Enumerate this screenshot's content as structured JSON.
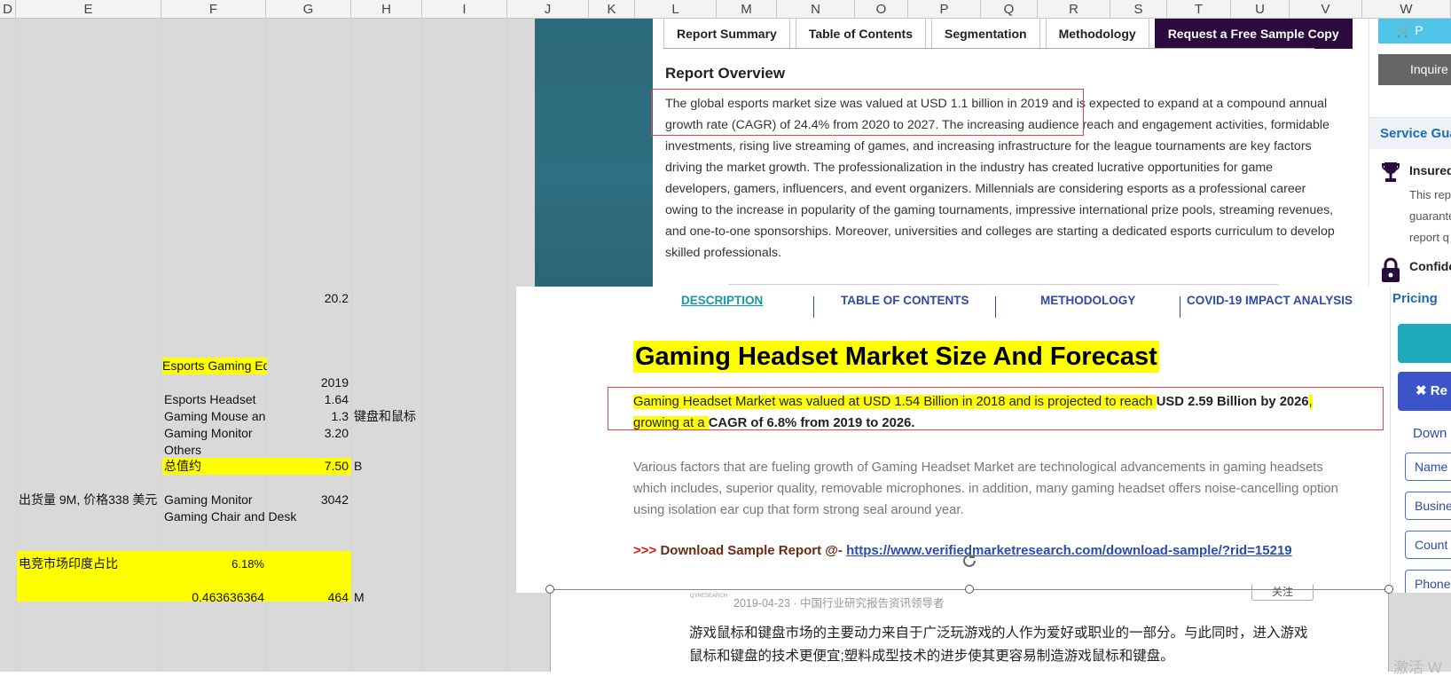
{
  "columns": [
    "D",
    "E",
    "F",
    "G",
    "H",
    "I",
    "J",
    "K",
    "L",
    "M",
    "N",
    "O",
    "P",
    "Q",
    "R",
    "S",
    "T",
    "U",
    "V",
    "W"
  ],
  "sheet": {
    "g_20_2": "20.2",
    "title_equipment": "Esports Gaming Equipment",
    "year": "2019",
    "headset": "Esports Headset",
    "headset_v": "1.64",
    "mouse": "Gaming Mouse and Keyboard",
    "mouse_v": "1.3",
    "mouse_note": "键盘和鼠标",
    "monitor": "Gaming Monitor",
    "monitor_v": "3.20",
    "others": "Others",
    "total": "总值约",
    "total_v": "7.50",
    "total_unit": "B",
    "shipment_note": "出货量 9M, 价格338 美元",
    "monitor2": "Gaming Monitor",
    "monitor2_v": "3042",
    "chair": "Gaming Chair and Desk",
    "india_label": "电竞市场印度占比",
    "india_pct": "6.18%",
    "ratio": "0.463636364",
    "ratio_v": "464",
    "ratio_unit": "M"
  },
  "report": {
    "tabs": [
      "Report Summary",
      "Table of Contents",
      "Segmentation",
      "Methodology",
      "Request a Free Sample Copy"
    ],
    "overview_title": "Report Overview",
    "overview_text": "The global esports market size was valued at USD 1.1 billion in 2019 and is expected to expand at a compound annual growth rate (CAGR) of 24.4% from 2020 to 2027. The increasing audience reach and engagement activities, formidable investments, rising live streaming of games, and increasing infrastructure for the league tournaments are key factors driving the market growth. The professionalization in the industry has created lucrative opportunities for game developers, gamers, influencers, and event organizers. Millennials are considering esports as a professional career owing to the increase in popularity of the gaming tournaments, impressive international prize pools, streaming revenues, and one-to-one sponsorships. Moreover, universities and colleges are starting a dedicated esports curriculum to develop skilled professionals.",
    "btn_cart": "P",
    "btn_inquire": "Inquire",
    "service_title": "Service Gua",
    "svc1_title": "Insured",
    "svc1_desc": "This rep guarante report q",
    "svc2_title": "Confide"
  },
  "headset": {
    "nav": [
      "DESCRIPTION",
      "TABLE OF CONTENTS",
      "METHODOLOGY",
      "COVID-19 IMPACT ANALYSIS"
    ],
    "title": "Gaming Headset Market Size And Forecast",
    "para_a": "Gaming Headset Market was valued at USD 1.54 Billion in 2018 and is projected to reach ",
    "para_b": "USD 2.59 Billion by 2026",
    "para_c": ", growing at a ",
    "para_d": "CAGR of 6.8% from 2019 to 2026.",
    "para2": "Various factors that are fueling growth of Gaming Headset Market are technological advancements in gaming headsets which includes, superior quality, removable microphones. in addition, many gaming headset offers noise-cancelling option using isolation ear cup that form strong seal around year.",
    "dl_arrow": ">>>",
    "dl_label": " Download Sample Report @- ",
    "dl_link": "https://www.verifiedmarketresearch.com/download-sample/?rid=15219",
    "pricing": "Pricing",
    "btn_re": "Re",
    "down": "Down",
    "fields": [
      "Name",
      "Busine",
      "Count",
      "Phone"
    ]
  },
  "article": {
    "logo": "QYRESEARCH",
    "meta": "2019-04-23 · 中国行业研究报告资讯领导者",
    "follow": "关注",
    "body": "游戏鼠标和键盘市场的主要动力来自于广泛玩游戏的人作为爱好或职业的一部分。与此同时，进入游戏鼠标和键盘的技术更便宜;塑料成型技术的进步使其更容易制造游戏鼠标和键盘。"
  },
  "watermark": "激活 W",
  "colors": {
    "highlight": "#ffff00",
    "redbox": "#e04545",
    "teal": "#2d6b7b",
    "navy": "#2e4aa8",
    "cta": "#2b0a3d"
  }
}
